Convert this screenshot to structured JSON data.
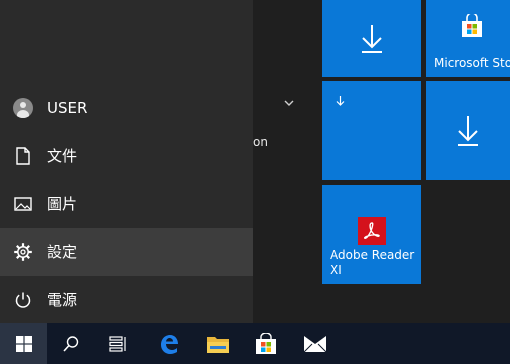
{
  "start_menu": {
    "rail": {
      "user_label": "USER",
      "documents_label": "文件",
      "pictures_label": "圖片",
      "settings_label": "設定",
      "power_label": "電源"
    },
    "apps_list": {
      "partial_label": "on"
    },
    "tiles": [
      {
        "name": "download-tile-1",
        "label": "",
        "icon": "download-arrow-icon"
      },
      {
        "name": "microsoft-store-tile",
        "label": "Microsoft Store",
        "icon": "store-bag-icon"
      },
      {
        "name": "download-tile-2",
        "label": "",
        "icon": "download-arrow-icon"
      },
      {
        "name": "download-tile-3",
        "label": "",
        "icon": "download-arrow-icon"
      },
      {
        "name": "adobe-reader-tile",
        "label": "Adobe Reader XI",
        "icon": "adobe-reader-icon"
      }
    ]
  },
  "taskbar": {
    "items": [
      "windows-start",
      "search",
      "task-view",
      "edge",
      "file-explorer",
      "store",
      "mail"
    ]
  },
  "colors": {
    "tile_blue": "#0A78D7",
    "rail_bg": "#2B2B2B",
    "rail_active": "#3D3D3D",
    "taskbar_bg": "#101828",
    "adobe_red": "#D4121C"
  }
}
